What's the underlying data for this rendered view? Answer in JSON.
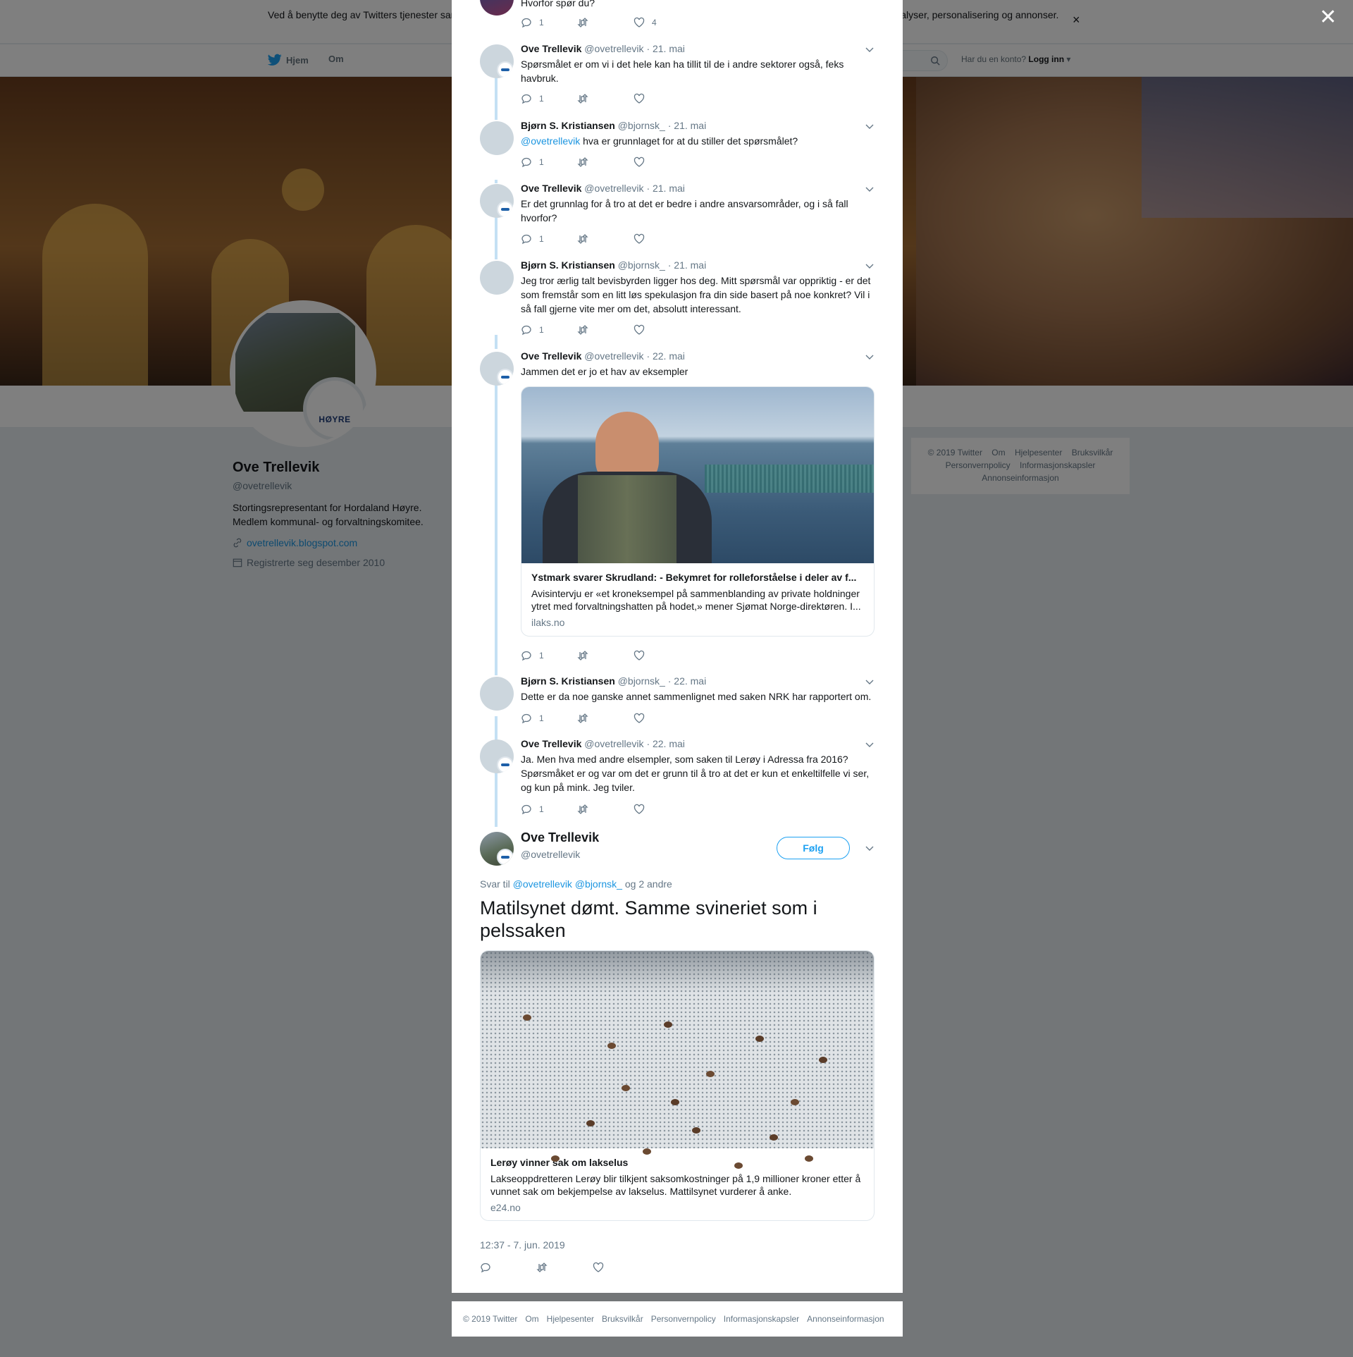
{
  "cookie": {
    "text": "Ved å benytte deg av Twitters tjenester samtykker du i vår bruk av informasjonskapsler. Vi og våre partnere bruker informasjonskapsler til bl.a. analyser, personalisering og annonser.",
    "close": "×"
  },
  "nav": {
    "home": "Hjem",
    "about": "Om",
    "login_prompt": "Har du en konto?",
    "login": "Logg inn"
  },
  "profile": {
    "name": "Ove Trellevik",
    "handle": "@ovetrellevik",
    "bio_line1": "Stortingsrepresentant for Hordaland Høyre.",
    "bio_line2": "Medlem kommunal- og forvaltningskomitee.",
    "url": "ovetrellevik.blogspot.com",
    "joined": "Registrerte seg desember 2010",
    "logo_text": "HØYRE"
  },
  "side_footer": [
    "© 2019 Twitter",
    "Om",
    "Hjelpesenter",
    "Bruksvilkår",
    "Personvernpolicy",
    "Informasjonskapsler",
    "Annonseinformasjon"
  ],
  "overlay_close": "✕",
  "top_fragment": {
    "text": "Hvorfor spør du?",
    "replies": "1",
    "likes": "4"
  },
  "thread": [
    {
      "name": "Ove Trellevik",
      "handle": "@ovetrellevik",
      "date": "· 21. mai",
      "text": "Spørsmålet er om vi i det hele kan ha tillit til de i andre sektorer også, feks havbruk.",
      "replies": "1"
    },
    {
      "name": "Bjørn S. Kristiansen",
      "handle": "@bjornsk_",
      "date": "· 21. mai",
      "mention": "@ovetrellevik",
      "text": " hva er grunnlaget for at du stiller det spørsmålet?",
      "replies": "1"
    },
    {
      "name": "Ove Trellevik",
      "handle": "@ovetrellevik",
      "date": "· 21. mai",
      "text": "Er det grunnlag for å tro at det er bedre i andre ansvarsområder, og i så fall hvorfor?",
      "replies": "1"
    },
    {
      "name": "Bjørn S. Kristiansen",
      "handle": "@bjornsk_",
      "date": "· 21. mai",
      "text": "Jeg tror ærlig talt bevisbyrden ligger hos deg. Mitt spørsmål var oppriktig - er det som fremstår som en litt løs spekulasjon fra din side basert på noe konkret? Vil i så fall gjerne vite mer om det, absolutt interessant.",
      "replies": "1"
    },
    {
      "name": "Ove Trellevik",
      "handle": "@ovetrellevik",
      "date": "· 22. mai",
      "text": "Jammen det er jo et hav av eksempler",
      "replies": "1",
      "card": {
        "title": "Ystmark svarer Skrudland: - Bekymret for rolleforståelse i deler av f...",
        "desc": "Avisintervju er «et kroneksempel på sammenblanding av private holdninger ytret med forvaltningshatten på hodet,» mener Sjømat Norge-direktøren. I...",
        "domain": "ilaks.no"
      }
    },
    {
      "name": "Bjørn S. Kristiansen",
      "handle": "@bjornsk_",
      "date": "· 22. mai",
      "text": "Dette er da noe ganske annet sammenlignet med saken NRK har rapportert om.",
      "replies": "1"
    },
    {
      "name": "Ove Trellevik",
      "handle": "@ovetrellevik",
      "date": "· 22. mai",
      "text": "Ja. Men hva med andre elsempler, som saken til Lerøy i Adressa fra 2016? Spørsmåket er og var om det er grunn til å tro at det er kun et enkeltilfelle vi ser, og kun på mink. Jeg tviler.",
      "replies": "1"
    }
  ],
  "main": {
    "name": "Ove Trellevik",
    "handle": "@ovetrellevik",
    "follow": "Følg",
    "reply_prefix": "Svar til",
    "reply_m1": "@ovetrellevik",
    "reply_m2": "@bjornsk_",
    "reply_suffix": "og 2 andre",
    "text": "Matilsynet dømt. Samme svineriet som i pelssaken",
    "card": {
      "title": "Lerøy vinner sak om lakselus",
      "desc": "Lakseoppdretteren Lerøy blir tilkjent saksomkostninger på 1,9 millioner kroner etter å vunnet sak om bekjempelse av lakselus. Mattilsynet vurderer å anke.",
      "domain": "e24.no"
    },
    "timestamp": "12:37 - 7. jun. 2019"
  },
  "modal_footer": [
    "© 2019 Twitter",
    "Om",
    "Hjelpesenter",
    "Bruksvilkår",
    "Personvernpolicy",
    "Informasjonskapsler",
    "Annonseinformasjon"
  ]
}
